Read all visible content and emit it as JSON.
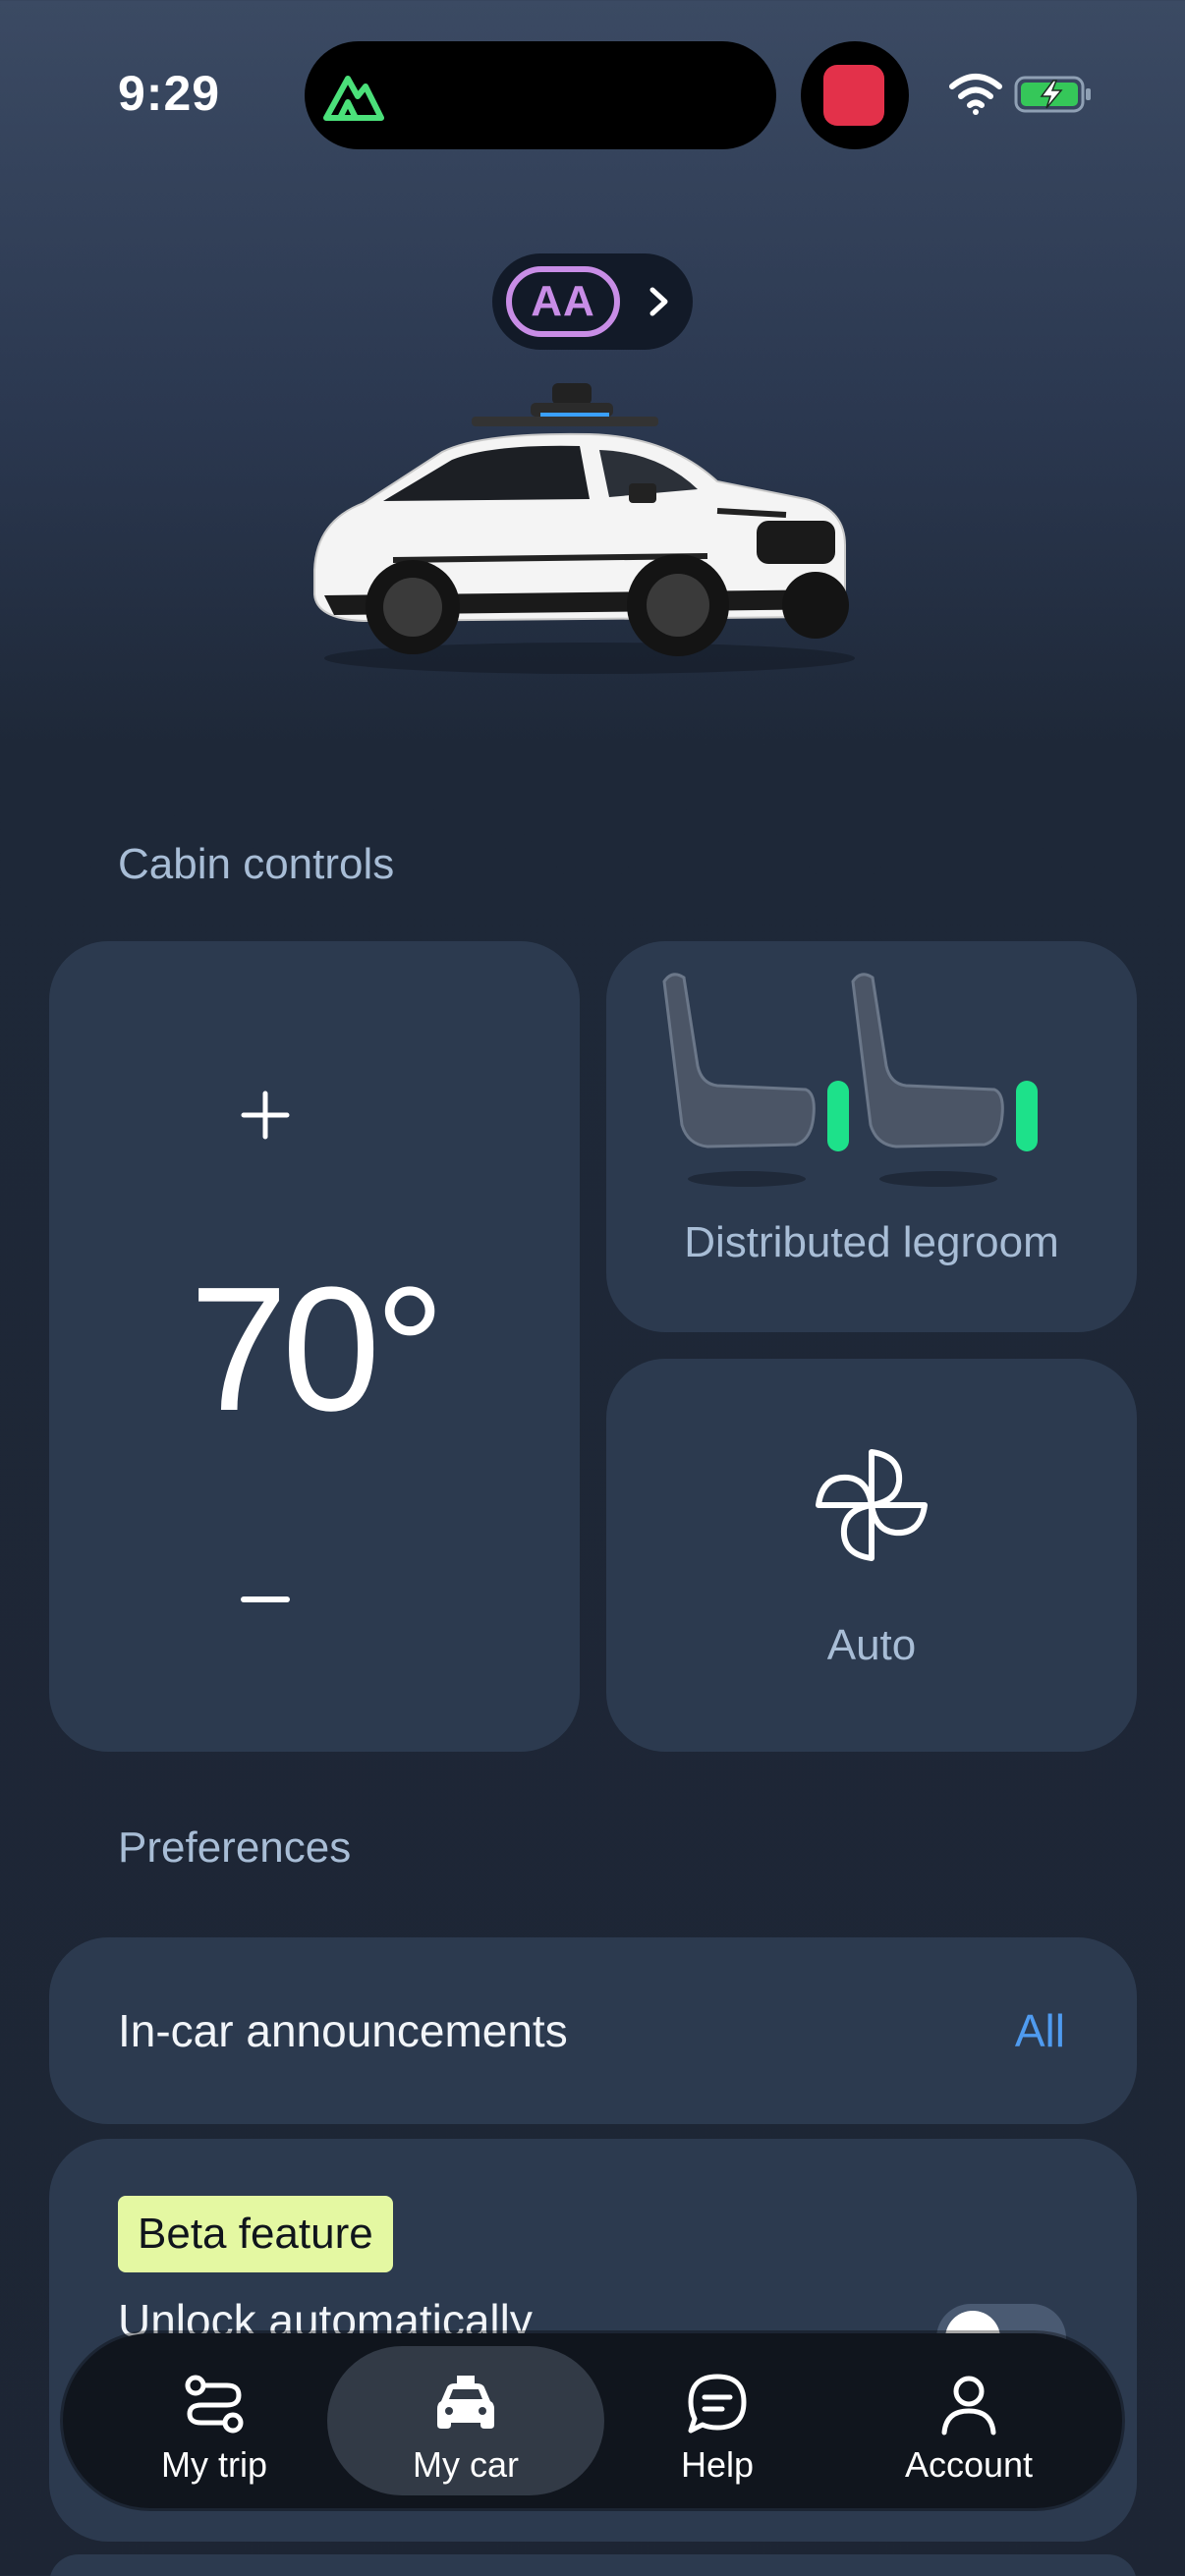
{
  "status_bar": {
    "time": "9:29"
  },
  "profile": {
    "initials": "AA"
  },
  "cabin_controls": {
    "section_title": "Cabin controls",
    "temperature": "70°",
    "legroom_label": "Distributed legroom",
    "fan_label": "Auto"
  },
  "preferences": {
    "section_title": "Preferences",
    "announcements_label": "In-car announcements",
    "announcements_value": "All",
    "beta_badge": "Beta feature",
    "unlock_label": "Unlock automatically"
  },
  "tabs": [
    {
      "label": "My trip",
      "icon": "route-icon"
    },
    {
      "label": "My car",
      "icon": "car-icon",
      "active": true
    },
    {
      "label": "Help",
      "icon": "chat-bubble-icon"
    },
    {
      "label": "Account",
      "icon": "person-icon"
    }
  ],
  "colors": {
    "accent_blue": "#4f9bf0",
    "seat_indicator": "#1de18a",
    "initials_purple": "#c88de6",
    "beta_badge_bg": "#e4f8a2"
  }
}
